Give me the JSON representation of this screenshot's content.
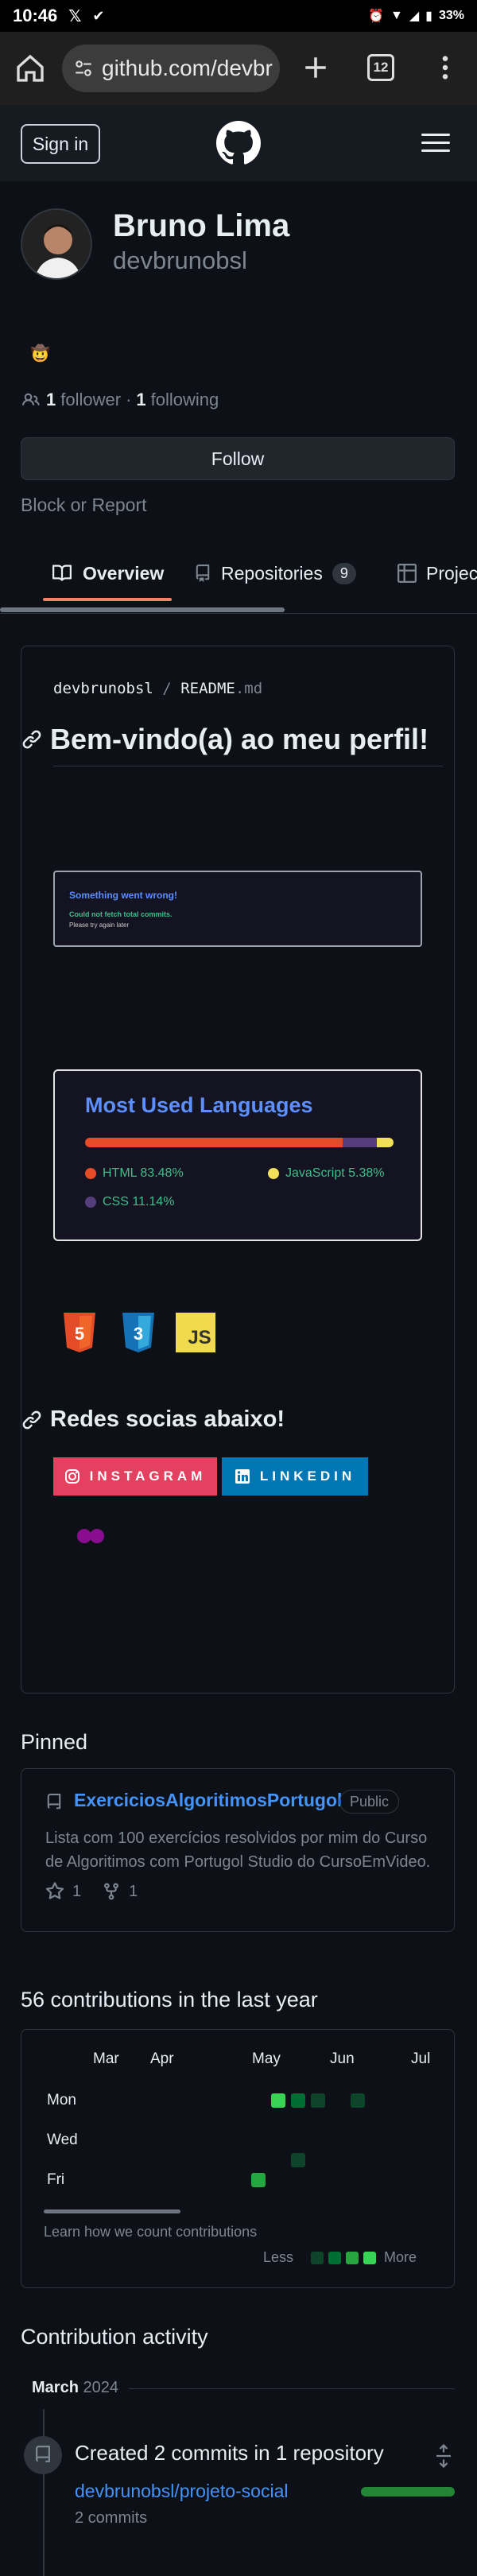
{
  "status": {
    "time": "10:46",
    "battery": "33%"
  },
  "browser": {
    "url": "github.com/devbr",
    "tab_count": "12"
  },
  "header": {
    "signin_label": "Sign in"
  },
  "profile": {
    "name": "Bruno Lima",
    "login": "devbrunobsl",
    "status_emoji": "🤠",
    "followers_count": "1",
    "followers_label": "follower",
    "separator": "·",
    "following_count": "1",
    "following_label": "following",
    "follow_label": "Follow",
    "block_label": "Block or Report"
  },
  "tabs": [
    {
      "label": "Overview"
    },
    {
      "label": "Repositories",
      "count": "9"
    },
    {
      "label": "Projects"
    }
  ],
  "readme": {
    "path_user": "devbrunobsl",
    "path_sep": "/",
    "path_file": "README",
    "path_ext": ".md",
    "heading": "Bem-vindo(a) ao meu perfil!",
    "error_card": {
      "title": "Something went wrong!",
      "line1": "Could not fetch total commits.",
      "line2": "Please try again later"
    },
    "languages_card": {
      "title": "Most Used Languages",
      "langs": [
        {
          "name": "HTML",
          "percent": 83.48,
          "label": "HTML 83.48%",
          "color": "#e34c26"
        },
        {
          "name": "CSS",
          "percent": 11.14,
          "label": "CSS 11.14%",
          "color": "#563d7c"
        },
        {
          "name": "JavaScript",
          "percent": 5.38,
          "label": "JavaScript 5.38%",
          "color": "#f1e05a"
        }
      ]
    },
    "tech_icons": [
      "html5-icon",
      "css3-icon",
      "javascript-icon"
    ],
    "tech_labels": {
      "html": "5",
      "css": "3",
      "js": "JS"
    },
    "social_heading": "Redes socias abaixo!",
    "badges": [
      {
        "label": "INSTAGRAM",
        "color": "#e4405f"
      },
      {
        "label": "LINKEDIN",
        "color": "#0077b5"
      }
    ]
  },
  "pinned": {
    "title": "Pinned",
    "repo": "ExerciciosAlgoritimosPortugol",
    "visibility": "Public",
    "description": "Lista com 100 exercícios resolvidos por mim do Curso de Algoritimos com Portugol Studio do CursoEmVideo.",
    "stars": "1",
    "forks": "1"
  },
  "contributions": {
    "title": "56 contributions in the last year",
    "months": [
      "Mar",
      "Apr",
      "May",
      "Jun",
      "Jul"
    ],
    "days": [
      "Mon",
      "Wed",
      "Fri"
    ],
    "learn": "Learn how we count contributions",
    "less": "Less",
    "more": "More",
    "colors": [
      "#0e4429",
      "#006d32",
      "#26a641",
      "#39d353"
    ]
  },
  "activity": {
    "title": "Contribution activity",
    "month": "March",
    "year": "2024",
    "summary": "Created 2 commits in 1 repository",
    "repo": "devbrunobsl/projeto-social",
    "commits": "2 commits"
  }
}
